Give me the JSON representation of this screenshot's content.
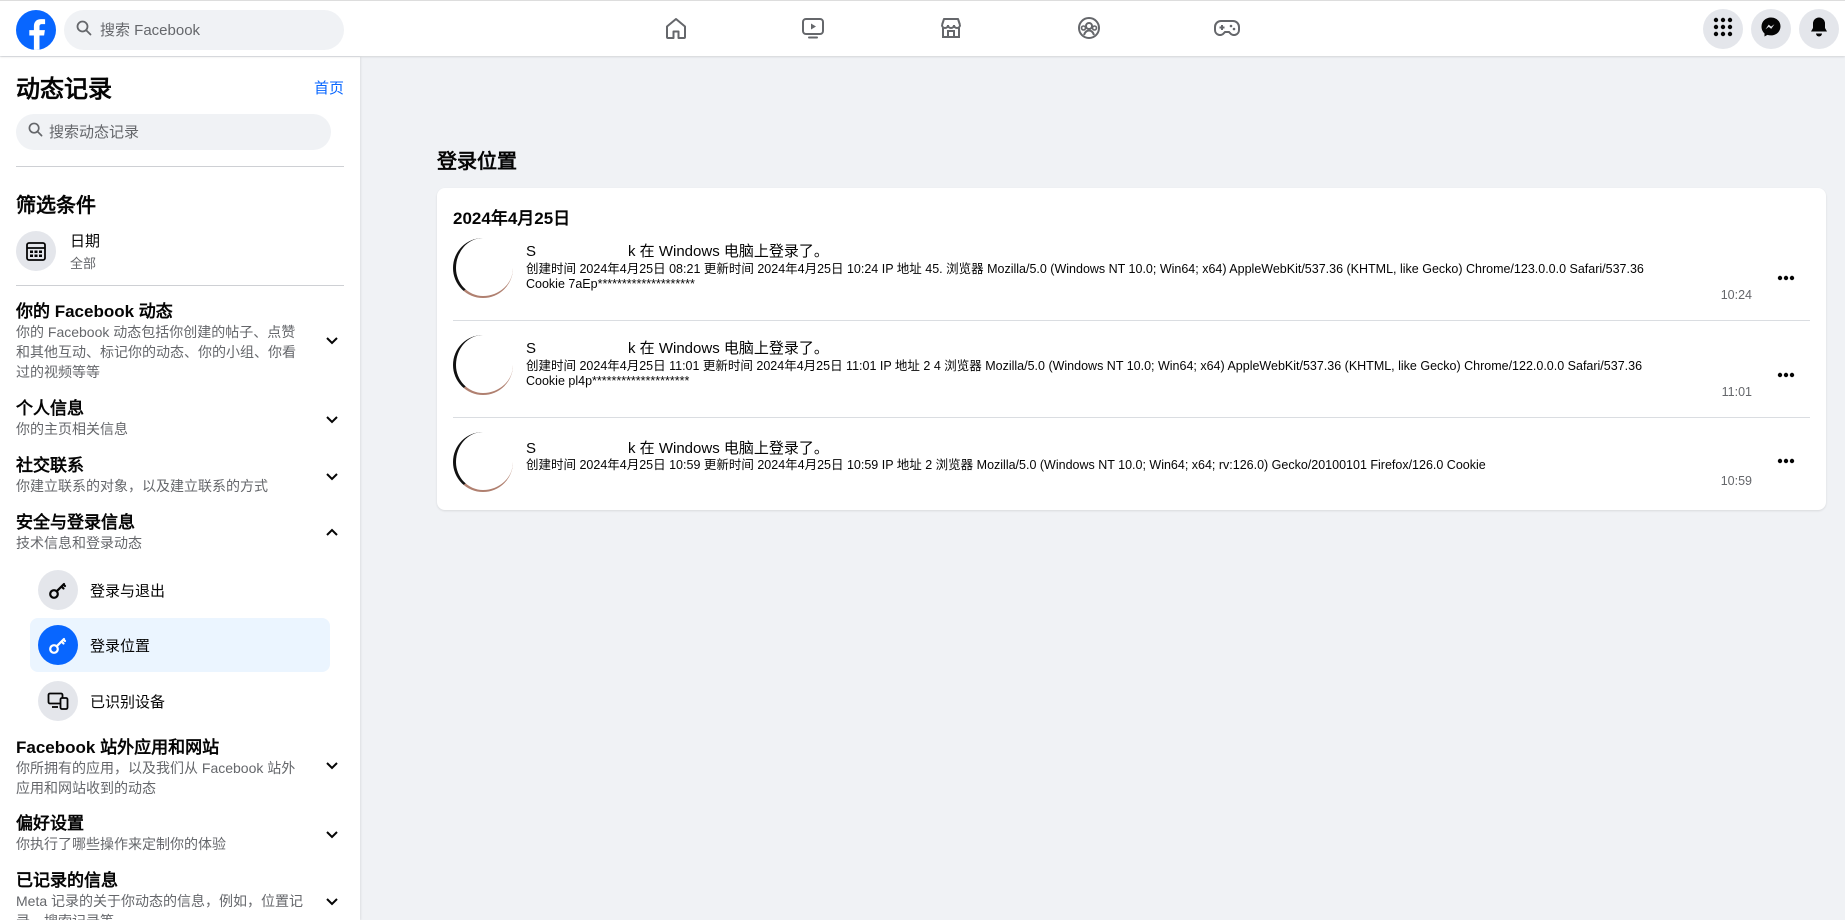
{
  "topbar": {
    "search_placeholder": "搜索 Facebook"
  },
  "sidebar": {
    "title": "动态记录",
    "home_link": "首页",
    "search_placeholder": "搜索动态记录",
    "filter_heading": "筛选条件",
    "date_filter": {
      "label": "日期",
      "value": "全部"
    },
    "sections": [
      {
        "title": "你的 Facebook 动态",
        "desc": "你的 Facebook 动态包括你创建的帖子、点赞和其他互动、标记你的动态、你的小组、你看过的视频等等",
        "expanded": false
      },
      {
        "title": "个人信息",
        "desc": "你的主页相关信息",
        "expanded": false
      },
      {
        "title": "社交联系",
        "desc": "你建立联系的对象，以及建立联系的方式",
        "expanded": false
      },
      {
        "title": "安全与登录信息",
        "desc": "技术信息和登录动态",
        "expanded": true
      },
      {
        "title": "Facebook 站外应用和网站",
        "desc": "你所拥有的应用，以及我们从 Facebook 站外应用和网站收到的动态",
        "expanded": false
      },
      {
        "title": "偏好设置",
        "desc": "你执行了哪些操作来定制你的体验",
        "expanded": false
      },
      {
        "title": "已记录的信息",
        "desc": "Meta 记录的关于你动态的信息，例如，位置记录、搜索记录等",
        "expanded": false
      }
    ],
    "security_subitems": [
      {
        "label": "登录与退出",
        "active": false
      },
      {
        "label": "登录位置",
        "active": true
      },
      {
        "label": "已识别设备",
        "active": false
      }
    ]
  },
  "main": {
    "title": "登录位置",
    "date_header": "2024年4月25日",
    "entries": [
      {
        "head_prefix": "S",
        "head_suffix": "k 在 Windows 电脑上登录了。",
        "detail_line1": "创建时间 2024年4月25日 08:21 更新时间 2024年4月25日 10:24 IP 地址 45.                      浏览器 Mozilla/5.0 (Windows NT 10.0; Win64; x64) AppleWebKit/537.36 (KHTML, like Gecko) Chrome/123.0.0.0 Safari/537.36",
        "detail_line2": "Cookie 7aEp********************",
        "time": "10:24"
      },
      {
        "head_prefix": "S",
        "head_suffix": "k 在 Windows 电脑上登录了。",
        "detail_line1": "创建时间 2024年4月25日 11:01 更新时间 2024年4月25日 11:01 IP 地址 2                        4 浏览器 Mozilla/5.0 (Windows NT 10.0; Win64; x64) AppleWebKit/537.36 (KHTML, like Gecko) Chrome/122.0.0.0 Safari/537.36",
        "detail_line2": "Cookie pl4p********************",
        "time": "11:01"
      },
      {
        "head_prefix": "S",
        "head_suffix": "k 在 Windows 电脑上登录了。",
        "detail_line1": "创建时间 2024年4月25日 10:59 更新时间 2024年4月25日 10:59 IP 地址 2                          浏览器 Mozilla/5.0 (Windows NT 10.0; Win64; x64; rv:126.0) Gecko/20100101 Firefox/126.0 Cookie",
        "detail_line2": "",
        "time": "10:59"
      }
    ]
  },
  "colors": {
    "brand": "#0866ff",
    "background": "#f0f2f5",
    "secondary_text": "#65676b",
    "active_item_bg": "#ebf5ff"
  },
  "icons": [
    "facebook-logo",
    "search-icon",
    "home-icon",
    "video-icon",
    "marketplace-icon",
    "groups-icon",
    "gaming-icon",
    "menu-grid-icon",
    "messenger-icon",
    "bell-icon",
    "calendar-icon",
    "chevron-down-icon",
    "chevron-up-icon",
    "key-icon",
    "devices-icon",
    "more-icon"
  ]
}
